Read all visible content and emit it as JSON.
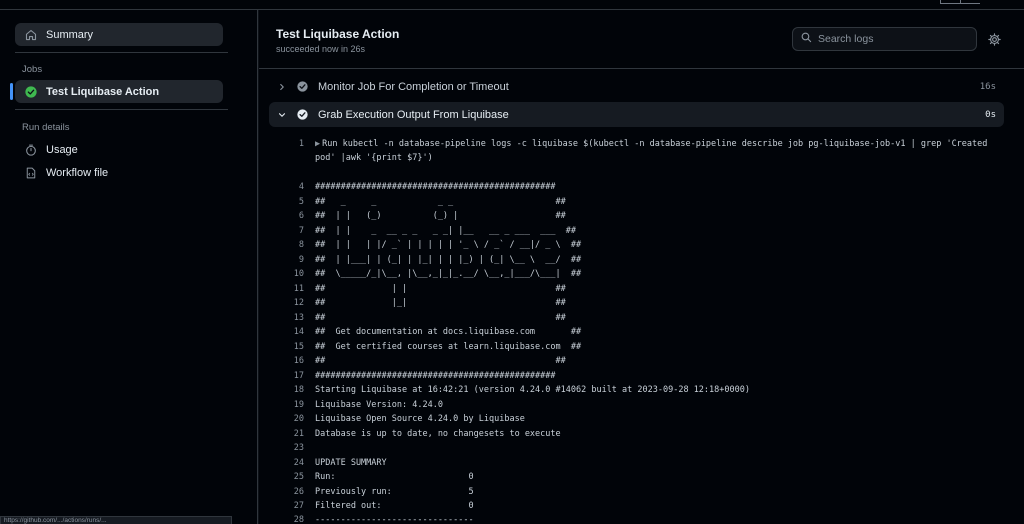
{
  "sidebar": {
    "summary_label": "Summary",
    "jobs_heading": "Jobs",
    "job_label": "Test Liquibase Action",
    "run_details_heading": "Run details",
    "usage_label": "Usage",
    "workflow_file_label": "Workflow file"
  },
  "header": {
    "title": "Test Liquibase Action",
    "status": "succeeded now in 26s",
    "search_placeholder": "Search logs"
  },
  "steps": [
    {
      "label": "Monitor Job For Completion or Timeout",
      "time": "16s",
      "expanded": false
    },
    {
      "label": "Grab Execution Output From Liquibase",
      "time": "0s",
      "expanded": true
    }
  ],
  "log_lines": [
    {
      "n": "1",
      "text": "Run kubectl -n database-pipeline logs -c liquibase $(kubectl -n database-pipeline describe job pg-liquibase-job-v1 | grep 'Created"
    },
    {
      "n": "",
      "text": "pod' |awk '{print $7}')"
    },
    {
      "n": "4",
      "text": "###############################################"
    },
    {
      "n": "5",
      "text": "##   _     _            _ _                    ##"
    },
    {
      "n": "6",
      "text": "##  | |   (_)          (_) |                   ##"
    },
    {
      "n": "7",
      "text": "##  | |    _  __ _ _   _ _| |__   __ _ ___  ___  ##"
    },
    {
      "n": "8",
      "text": "##  | |   | |/ _` | | | | | '_ \\ / _` / __|/ _ \\  ##"
    },
    {
      "n": "9",
      "text": "##  | |___| | (_| | |_| | | |_) | (_| \\__ \\  __/  ##"
    },
    {
      "n": "10",
      "text": "##  \\_____/_|\\__, |\\__,_|_|_.__/ \\__,_|___/\\___|  ##"
    },
    {
      "n": "11",
      "text": "##             | |                             ##"
    },
    {
      "n": "12",
      "text": "##             |_|                             ##"
    },
    {
      "n": "13",
      "text": "##                                             ##"
    },
    {
      "n": "14",
      "text": "##  Get documentation at docs.liquibase.com       ##"
    },
    {
      "n": "15",
      "text": "##  Get certified courses at learn.liquibase.com  ##"
    },
    {
      "n": "16",
      "text": "##                                             ##"
    },
    {
      "n": "17",
      "text": "###############################################"
    },
    {
      "n": "18",
      "text": "Starting Liquibase at 16:42:21 (version 4.24.0 #14062 built at 2023-09-28 12:18+0000)"
    },
    {
      "n": "19",
      "text": "Liquibase Version: 4.24.0"
    },
    {
      "n": "20",
      "text": "Liquibase Open Source 4.24.0 by Liquibase"
    },
    {
      "n": "21",
      "text": "Database is up to date, no changesets to execute"
    },
    {
      "n": "23",
      "text": ""
    },
    {
      "n": "24",
      "text": "UPDATE SUMMARY"
    },
    {
      "n": "25",
      "text": "Run:                          0"
    },
    {
      "n": "26",
      "text": "Previously run:               5"
    },
    {
      "n": "27",
      "text": "Filtered out:                 0"
    },
    {
      "n": "28",
      "text": "-------------------------------"
    }
  ],
  "status_bar_url": "https://github.com/.../actions/runs/...",
  "colors": {
    "accent": "#4493f8",
    "success": "#3fb950",
    "check_gray": "#8b949e",
    "background": "#010409"
  },
  "icons": {
    "summary": "home-icon",
    "job": "check-circle-fill-icon",
    "usage": "stopwatch-icon",
    "workflow": "file-code-icon",
    "search": "search-icon",
    "settings": "gear-icon"
  }
}
